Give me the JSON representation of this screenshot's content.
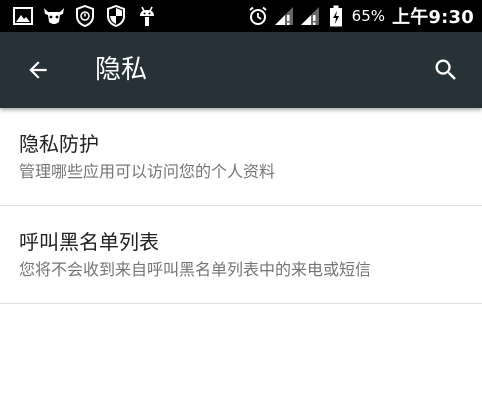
{
  "status_bar": {
    "battery_percent": "65%",
    "time": "上午9:30",
    "left_icons": [
      "gallery-icon",
      "ox-head-icon",
      "shield-icon",
      "shield-icon",
      "android-icon"
    ],
    "right_icons": [
      "alarm-icon",
      "signal-icon",
      "signal-icon",
      "battery-charging-icon"
    ]
  },
  "app_bar": {
    "title": "隐私",
    "background": "#263238"
  },
  "settings": {
    "items": [
      {
        "title": "隐私防护",
        "summary": "管理哪些应用可以访问您的个人资料"
      },
      {
        "title": "呼叫黑名单列表",
        "summary": "您将不会收到来自呼叫黑名单列表中的来电或短信"
      }
    ]
  }
}
